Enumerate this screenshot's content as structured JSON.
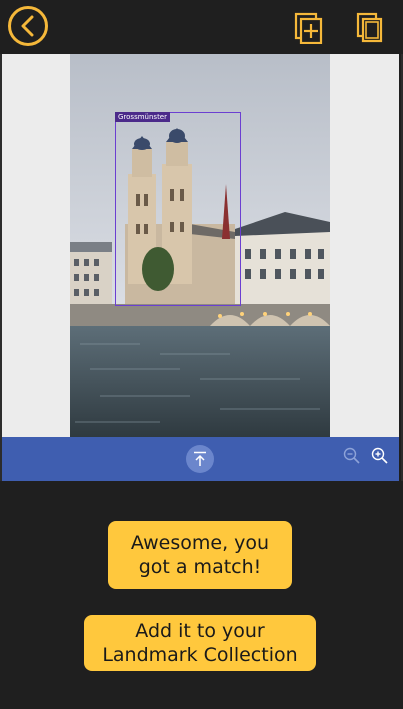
{
  "header": {
    "back_icon": "back-arrow-icon",
    "add_icon": "add-image-icon",
    "collection_icon": "copy-collection-icon",
    "accent_color": "#f5b83a"
  },
  "viewer": {
    "detection": {
      "label": "Grossmünster"
    },
    "toolbar": {
      "background": "#3f5eb0",
      "upload_icon": "upload-icon",
      "zoom_out_icon": "zoom-out-icon",
      "zoom_in_icon": "zoom-in-icon"
    }
  },
  "result": {
    "match_message": "Awesome, you got a match!",
    "add_button_label": "Add it to your Landmark Collection",
    "button_color": "#ffc83d"
  }
}
